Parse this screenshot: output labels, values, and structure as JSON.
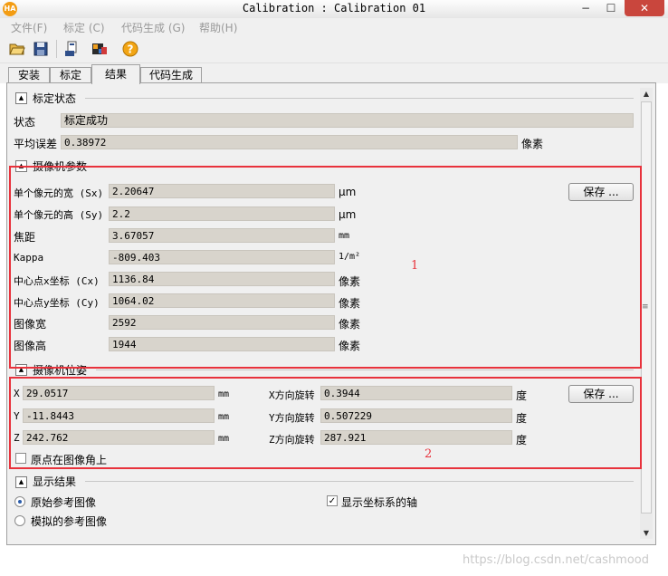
{
  "window": {
    "app_icon": "HA",
    "title": "Calibration : Calibration 01",
    "minimize": "−",
    "maximize": "☐",
    "close": "✕"
  },
  "menu": [
    "文件(F)",
    "标定 (C)",
    "代码生成 (G)",
    "帮助(H)"
  ],
  "toolbar": {
    "icons": [
      "open-folder-icon",
      "save-icon",
      "export-icon",
      "camera-icon",
      "help-icon"
    ]
  },
  "tabs": [
    "安装",
    "标定",
    "结果",
    "代码生成"
  ],
  "active_tab": "结果",
  "status_section": {
    "title": "标定状态",
    "status_label": "状态",
    "status_value": "标定成功",
    "mean_error_label": "平均误差",
    "mean_error_value": "0.38972",
    "mean_error_unit": "像素"
  },
  "camera_params": {
    "title": "摄像机参数",
    "save_button": "保存 ...",
    "rows": [
      {
        "label": "单个像元的宽 (Sx)",
        "value": "2.20647",
        "unit": "μm"
      },
      {
        "label": "单个像元的高 (Sy)",
        "value": "2.2",
        "unit": "μm"
      },
      {
        "label": "焦距",
        "value": "3.67057",
        "unit": "mm"
      },
      {
        "label": "Kappa",
        "value": "-809.403",
        "unit": "1/m²"
      },
      {
        "label": "中心点x坐标 (Cx)",
        "value": "1136.84",
        "unit": "像素"
      },
      {
        "label": "中心点y坐标 (Cy)",
        "value": "1064.02",
        "unit": "像素"
      },
      {
        "label": "图像宽",
        "value": "2592",
        "unit": "像素"
      },
      {
        "label": "图像高",
        "value": "1944",
        "unit": "像素"
      }
    ]
  },
  "camera_pose": {
    "title": "摄像机位姿",
    "save_button": "保存 ...",
    "translation": [
      {
        "label": "X",
        "value": "29.0517",
        "unit": "mm"
      },
      {
        "label": "Y",
        "value": "-11.8443",
        "unit": "mm"
      },
      {
        "label": "Z",
        "value": "242.762",
        "unit": "mm"
      }
    ],
    "rotation": [
      {
        "label": "X方向旋转",
        "value": "0.3944",
        "unit": "度"
      },
      {
        "label": "Y方向旋转",
        "value": "0.507229",
        "unit": "度"
      },
      {
        "label": "Z方向旋转",
        "value": "287.921",
        "unit": "度"
      }
    ],
    "origin_checkbox": {
      "label": "原点在图像角上",
      "checked": false
    }
  },
  "display_section": {
    "title": "显示结果",
    "radio_original": {
      "label": "原始参考图像",
      "selected": true
    },
    "radio_simulated": {
      "label": "模拟的参考图像",
      "selected": false
    },
    "axes_checkbox": {
      "label": "显示坐标系的轴",
      "checked": true
    }
  },
  "annotations": [
    "1",
    "2"
  ],
  "watermark": "https://blog.csdn.net/cashmood",
  "colors": {
    "annotation": "#e8323c",
    "field_bg": "#d8d4cc",
    "panel_bg": "#f0f0f0"
  }
}
